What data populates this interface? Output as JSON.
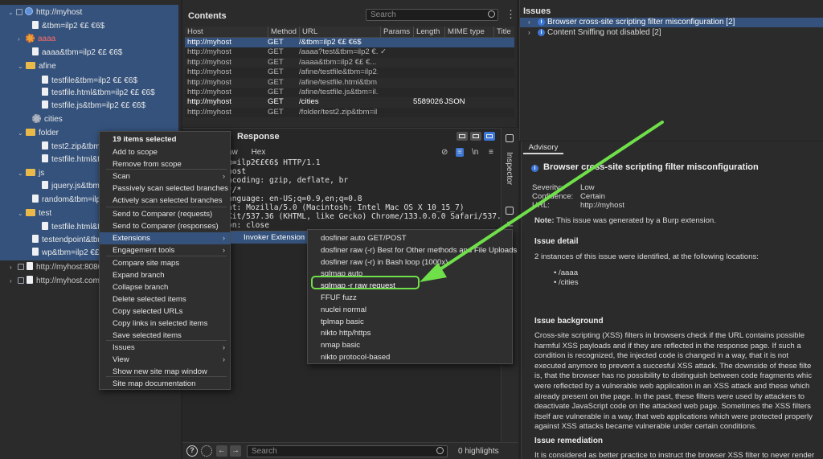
{
  "sitemap": {
    "rows": [
      {
        "label": "http://myhost",
        "icon": "globe",
        "tw": "v",
        "cb": true
      },
      {
        "label": "&tbm=ilp2 €£   €6$",
        "icon": "file"
      },
      {
        "label": "aaaa",
        "icon": "gear",
        "tw": ">",
        "red": true
      },
      {
        "label": "aaaa&tbm=ilp2 €£   €6$",
        "icon": "file"
      },
      {
        "label": "afine",
        "icon": "folder",
        "tw": "v"
      },
      {
        "label": "testfile&tbm=ilp2 €£   €6$",
        "icon": "file"
      },
      {
        "label": "testfile.html&tbm=ilp2 €£   €6$",
        "icon": "file"
      },
      {
        "label": "testfile.js&tbm=ilp2 €£   €6$",
        "icon": "file"
      },
      {
        "label": "cities",
        "icon": "gear-gray"
      },
      {
        "label": "folder",
        "icon": "folder",
        "tw": "v"
      },
      {
        "label": "test2.zip&tbm=ilp",
        "icon": "file"
      },
      {
        "label": "testfile.html&tbm",
        "icon": "file"
      },
      {
        "label": "js",
        "icon": "folder",
        "tw": "v"
      },
      {
        "label": "jquery.js&tbm=ilp",
        "icon": "file"
      },
      {
        "label": "random&tbm=ilp2",
        "icon": "file"
      },
      {
        "label": "test",
        "icon": "folder",
        "tw": "v"
      },
      {
        "label": "testfile.html&tbm",
        "icon": "file"
      },
      {
        "label": "testendpoint&tbm=il",
        "icon": "file"
      },
      {
        "label": "wp&tbm=ilp2 €£",
        "icon": "file"
      },
      {
        "label": "http://myhost:8080",
        "icon": "file",
        "tw": ">",
        "cb": true
      },
      {
        "label": "http://myhost.com",
        "icon": "file",
        "tw": ">",
        "cb": true
      }
    ]
  },
  "contents": {
    "title": "Contents",
    "search_placeholder": "Search",
    "menu_glyph": "⋮",
    "columns": [
      "Host",
      "Method",
      "URL",
      "Params",
      "Length",
      "MIME type",
      "Title"
    ],
    "rows": [
      {
        "host": "http://myhost",
        "method": "GET",
        "url": "/&tbm=ilp2 €£   €6$",
        "params": "",
        "length": "",
        "mime": ""
      },
      {
        "host": "http://myhost",
        "method": "GET",
        "url": "/aaaa?test&tbm=ilp2 €...",
        "params": "✓",
        "length": "",
        "mime": ""
      },
      {
        "host": "http://myhost",
        "method": "GET",
        "url": "/aaaa&tbm=ilp2 €£   €...",
        "params": "",
        "length": "",
        "mime": ""
      },
      {
        "host": "http://myhost",
        "method": "GET",
        "url": "/afine/testfile&tbm=ilp2...",
        "params": "",
        "length": "",
        "mime": ""
      },
      {
        "host": "http://myhost",
        "method": "GET",
        "url": "/afine/testfile.html&tbm...",
        "params": "",
        "length": "",
        "mime": ""
      },
      {
        "host": "http://myhost",
        "method": "GET",
        "url": "/afine/testfile.js&tbm=il...",
        "params": "",
        "length": "",
        "mime": ""
      },
      {
        "host": "http://myhost",
        "method": "GET",
        "url": "/cities",
        "params": "",
        "length": "5589026",
        "mime": "JSON"
      },
      {
        "host": "http://myhost",
        "method": "GET",
        "url": "/folder/test2.zip&tbm=il...",
        "params": "",
        "length": "",
        "mime": ""
      }
    ]
  },
  "response": {
    "title": "Response",
    "tabs": [
      "aw",
      "Hex"
    ],
    "newline_label": "\\n",
    "lines": [
      "m=ilp2€£€6$ HTTP/1.1",
      "host",
      "ncoding: gzip, deflate, br",
      "*/*",
      "anguage: en-US;q=0.9,en;q=0.8",
      "nt: Mozilla/5.0 (Macintosh; Intel Mac OS X 10_15_7)",
      "Kit/537.36 (KHTML, like Gecko) Chrome/133.0.0.0 Safari/537.36",
      "on: close"
    ]
  },
  "inspector": {
    "label": "Inspector",
    "second": "N"
  },
  "bottombar": {
    "help": "?",
    "search_placeholder": "Search",
    "highlights": "0 highlights",
    "back": "←",
    "forward": "→"
  },
  "issues": {
    "title": "Issues",
    "items": [
      {
        "label": "Browser cross-site scripting filter misconfiguration [2]",
        "selected": true
      },
      {
        "label": "Content Sniffing not disabled [2]",
        "selected": false
      }
    ]
  },
  "advisory": {
    "tab": "Advisory",
    "heading": "Browser cross-site scripting filter misconfiguration",
    "severity_label": "Severity:",
    "severity": "Low",
    "confidence_label": "Confidence:",
    "confidence": "Certain",
    "url_label": "URL:",
    "url": "http://myhost",
    "note_label": "Note:",
    "note": "This issue was generated by a Burp extension.",
    "detail_heading": "Issue detail",
    "detail_text": "2 instances of this issue were identified, at the following locations:",
    "locations": [
      "/aaaa",
      "/cities"
    ],
    "background_heading": "Issue background",
    "background_lines": [
      "Cross-site scripting (XSS) filters in browsers check if the URL contains possible",
      "harmful XSS payloads and if they are reflected in the response page. If such a",
      "condition is recognized, the injected code is changed in a way, that it is not",
      "executed anymore to prevent a succesful XSS attack. The downside of these filte",
      "is, that the browser has no possibility to distinguish between code fragments whic",
      "were reflected by a vulnerable web application in an XSS attack and these which",
      "already present on the page. In the past, these filters were used by attackers to",
      "deactivate JavaScript code on the attacked web page. Sometimes the XSS filters",
      "itself are vulnerable in a way, that web applications which were protected properly",
      "against XSS attacks became vulnerable under certain conditions."
    ],
    "remediation_heading": "Issue remediation",
    "remediation_text": "It is considered as better practice to instruct the browser XSS filter to never render"
  },
  "context_menu": {
    "header": "19 items selected",
    "items": [
      {
        "label": "Add to scope"
      },
      {
        "label": "Remove from scope"
      },
      {
        "label": "Scan",
        "arrow": true
      },
      {
        "label": "Passively scan selected branches"
      },
      {
        "label": "Actively scan selected branches"
      },
      {
        "label": "Send to Comparer (requests)"
      },
      {
        "label": "Send to Comparer (responses)"
      },
      {
        "label": "Extensions",
        "arrow": true,
        "highlight": true
      },
      {
        "label": "Engagement tools",
        "arrow": true
      },
      {
        "label": "Compare site maps"
      },
      {
        "label": "Expand branch"
      },
      {
        "label": "Collapse branch"
      },
      {
        "label": "Delete selected items"
      },
      {
        "label": "Copy selected URLs"
      },
      {
        "label": "Copy links in selected items"
      },
      {
        "label": "Save selected items"
      },
      {
        "label": "Issues",
        "arrow": true
      },
      {
        "label": "View",
        "arrow": true
      },
      {
        "label": "Show new site map window"
      },
      {
        "label": "Site map documentation"
      }
    ]
  },
  "submenu1": {
    "label": "Invoker Extension",
    "arrow": "›"
  },
  "submenu2": {
    "items": [
      "dosfiner auto GET/POST",
      "dosfiner raw (-r) Best for Other methods and File Uploads",
      "dosfiner raw (-r) in Bash loop (1000x)",
      "sqlmap auto",
      "sqlmap -r raw request",
      "FFUF fuzz",
      "nuclei normal",
      "tplmap basic",
      "nikto http/https",
      "nmap basic",
      "nikto protocol-based"
    ],
    "highlighted_index": 4
  },
  "colors": {
    "accent": "#34527c",
    "highlight_box": "#6fe04a",
    "arrow": "#6fe04a",
    "info": "#3d77d6"
  }
}
